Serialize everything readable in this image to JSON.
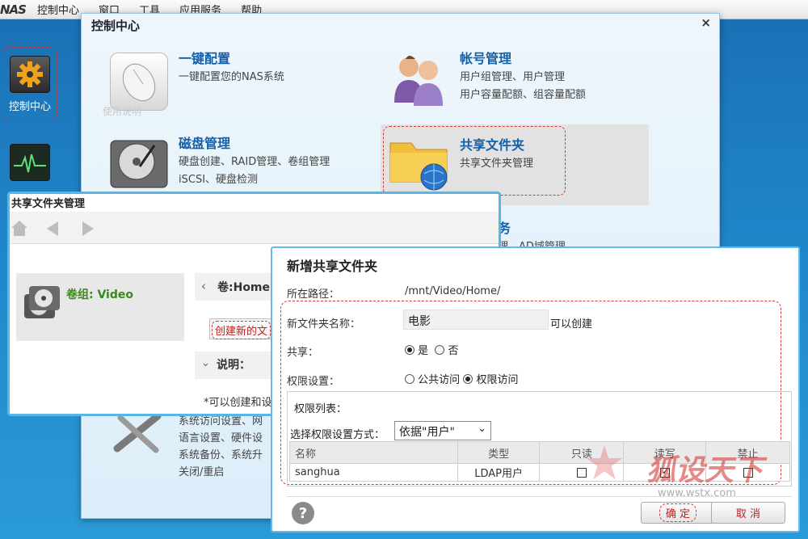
{
  "menubar": {
    "brand": "NAS",
    "items": [
      "控制中心",
      "窗口",
      "工具",
      "应用服务",
      "帮助"
    ]
  },
  "desktop": {
    "icons": [
      {
        "label": "控制中心",
        "icon": "gear-icon"
      },
      {
        "label": "",
        "icon": "monitor-icon"
      }
    ]
  },
  "control_center": {
    "title": "控制中心",
    "close_glyph": "×",
    "items": [
      {
        "title": "一键配置",
        "desc": [
          "一键配置您的NAS系统"
        ],
        "icon": "mouse-icon",
        "sub_label": "使用说明"
      },
      {
        "title": "帐号管理",
        "desc": [
          "用户组管理、用户管理",
          "用户容量配额、组容量配额"
        ],
        "icon": "users-icon"
      },
      {
        "title": "磁盘管理",
        "desc": [
          "硬盘创建、RAID管理、卷组管理",
          "iSCSI、硬盘检测"
        ],
        "icon": "harddisk-icon"
      },
      {
        "title": "共享文件夹",
        "desc": [
          "共享文件夹管理"
        ],
        "icon": "shared-folder-icon"
      },
      {
        "title": "务",
        "desc": [
          "理、AD域管理"
        ]
      },
      {
        "title": "",
        "desc": [
          "系统访问设置、网",
          "语言设置、硬件设",
          "系统备份、系统升",
          "关闭/重启"
        ],
        "icon": "tools-icon"
      }
    ]
  },
  "share_manager": {
    "title": "共享文件夹管理",
    "volume_label": "卷组: Video",
    "path_label": "卷:Home",
    "create_button": "创建新的文",
    "info_title": "说明：",
    "info_text": "*可以创建和设"
  },
  "dialog": {
    "title": "新增共享文件夹",
    "path_label": "所在路径：",
    "path_value": "/mnt/Video/Home/",
    "name_label": "新文件夹名称：",
    "name_value": "电影",
    "name_hint": "可以创建",
    "share_label": "共享：",
    "share_yes": "是",
    "share_no": "否",
    "perm_label": "权限设置：",
    "perm_public": "公共访问",
    "perm_restricted": "权限访问",
    "perm_list_label": "权限列表：",
    "perm_mode_label": "选择权限设置方式：",
    "perm_mode_value": "依据\"用户\"",
    "columns": [
      "名称",
      "类型",
      "只读",
      "读写",
      "禁止"
    ],
    "rows": [
      {
        "name": "sanghua",
        "type": "LDAP用户",
        "readonly": false,
        "readwrite": true,
        "deny": false
      }
    ],
    "ok": "确 定",
    "cancel": "取 消"
  },
  "watermark": {
    "main": "狐设天下",
    "sub": "www.wstx.com"
  },
  "colors": {
    "accent": "#1560a8",
    "dialog_border": "#63b9e8",
    "annotation": "#d23a3a"
  }
}
